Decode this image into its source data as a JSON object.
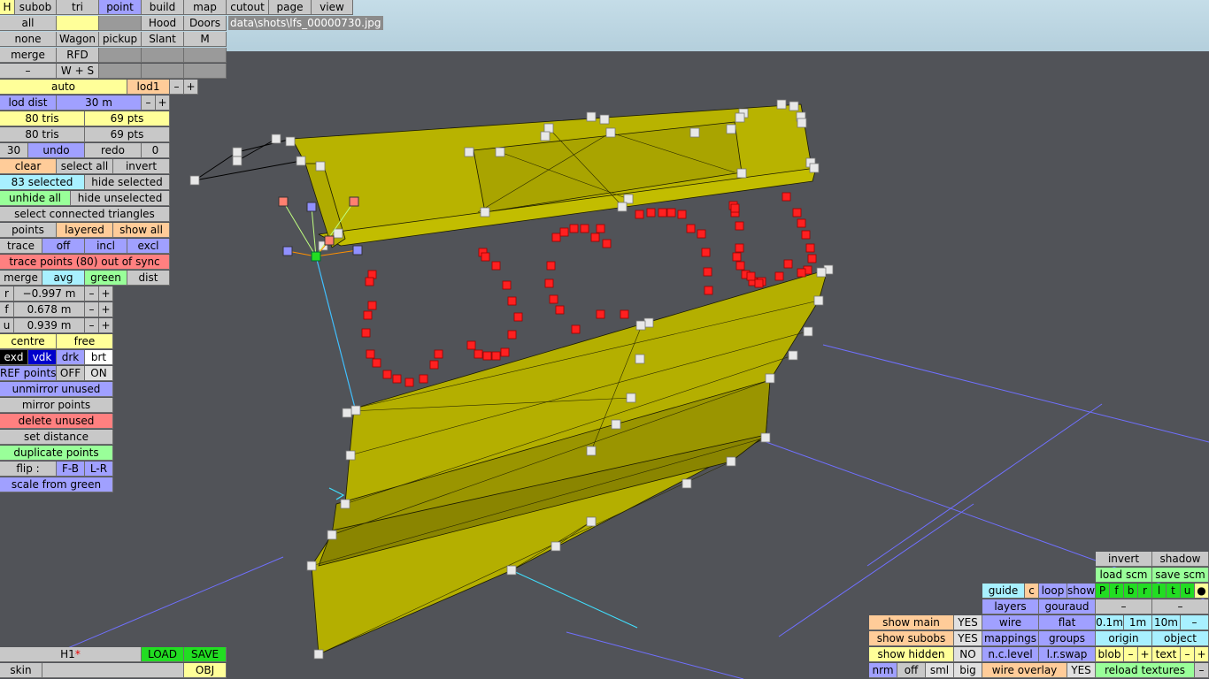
{
  "path": "data\\shots\\lfs_00000730.jpg",
  "menu": {
    "h": "H",
    "subob": "subob",
    "tri": "tri",
    "point": "point",
    "build": "build",
    "map": "map",
    "cutout": "cutout",
    "page": "page",
    "view": "view"
  },
  "row1": {
    "all": "all",
    "blank": "",
    "hood": "Hood",
    "doors": "Doors"
  },
  "row2": {
    "none": "none",
    "wagon": "Wagon",
    "pickup": "pickup",
    "slant": "Slant",
    "m": "M"
  },
  "row3": {
    "merge": "merge",
    "rfd": "RFD"
  },
  "row4": {
    "minus": "–",
    "ws": "W + S"
  },
  "lod": {
    "auto": "auto",
    "lod1": "lod1",
    "minus": "–",
    "plus": "+"
  },
  "loddist": {
    "label": "lod dist",
    "value": "30 m",
    "minus": "–",
    "plus": "+"
  },
  "counts": {
    "tris1": "80 tris",
    "pts1": "69 pts",
    "tris2": "80 tris",
    "pts2": "69 pts"
  },
  "undo": {
    "n": "30",
    "undo": "undo",
    "redo": "redo",
    "zero": "0"
  },
  "sel": {
    "clear": "clear",
    "select_all": "select all",
    "invert": "invert"
  },
  "selected": {
    "count": "83 selected",
    "hide_selected": "hide selected"
  },
  "hide": {
    "unhide_all": "unhide all",
    "hide_unselected": "hide unselected"
  },
  "select_connected": "select connected triangles",
  "points_row": {
    "points": "points",
    "layered": "layered",
    "show_all": "show all"
  },
  "trace": {
    "trace": "trace",
    "off": "off",
    "incl": "incl",
    "excl": "excl"
  },
  "trace_warning": "trace points (80) out of sync",
  "merge_row": {
    "merge": "merge",
    "avg": "avg",
    "green": "green",
    "dist": "dist"
  },
  "rfu": [
    {
      "axis": "r",
      "value": "−0.997 m",
      "minus": "–",
      "plus": "+"
    },
    {
      "axis": "f",
      "value": "0.678 m",
      "minus": "–",
      "plus": "+"
    },
    {
      "axis": "u",
      "value": "0.939 m",
      "minus": "–",
      "plus": "+"
    }
  ],
  "centre": {
    "centre": "centre",
    "free": "free"
  },
  "display": {
    "exd": "exd",
    "vdk": "vdk",
    "drk": "drk",
    "brt": "brt"
  },
  "ref": {
    "label": "REF points",
    "off": "OFF",
    "on": "ON"
  },
  "unmirror": "unmirror unused",
  "mirror": "mirror points",
  "delete_unused": "delete unused",
  "set_distance": "set distance",
  "duplicate": "duplicate points",
  "flip": {
    "label": "flip :",
    "fb": "F-B",
    "lr": "L-R"
  },
  "scale_green": "scale from green",
  "bottom_left": {
    "h1": "H1",
    "star": "*",
    "load": "LOAD",
    "save": "SAVE",
    "skin": "skin",
    "obj": "OBJ"
  },
  "br": {
    "invert": "invert",
    "shadow": "shadow",
    "load_scm": "load scm",
    "save_scm": "save scm",
    "guide": "guide",
    "c": "c",
    "loop": "loop",
    "show": "show",
    "pfbrltu": [
      "P",
      "f",
      "b",
      "r",
      "l",
      "t",
      "u"
    ],
    "dot": "●",
    "layers": "layers",
    "gouraud": "gouraud",
    "dash1": "–",
    "dash2": "–",
    "show_main": "show main",
    "yes1": "YES",
    "wire": "wire",
    "flat": "flat",
    "d01": "0.1m",
    "d1": "1m",
    "d10": "10m",
    "dminus": "–",
    "show_subobs": "show subobs",
    "yes2": "YES",
    "mappings": "mappings",
    "groups": "groups",
    "origin": "origin",
    "object": "object",
    "show_hidden": "show hidden",
    "no": "NO",
    "nclevel": "n.c.level",
    "lrswap": "l.r.swap",
    "blob": "blob",
    "blob_minus": "–",
    "blob_plus": "+",
    "text": "text",
    "text_minus": "–",
    "text_plus": "+",
    "nrm": "nrm",
    "off": "off",
    "sml": "sml",
    "big": "big",
    "wire_overlay": "wire overlay",
    "yes3": "YES",
    "reload_textures": "reload textures",
    "rminus": "–"
  },
  "colors": {
    "mesh_fill": "#b8b300",
    "mesh_dark": "#8c8700",
    "trace_point": "#ff2020",
    "vertex": "#e8e8e8",
    "selected_vertex": "#22dd22"
  }
}
